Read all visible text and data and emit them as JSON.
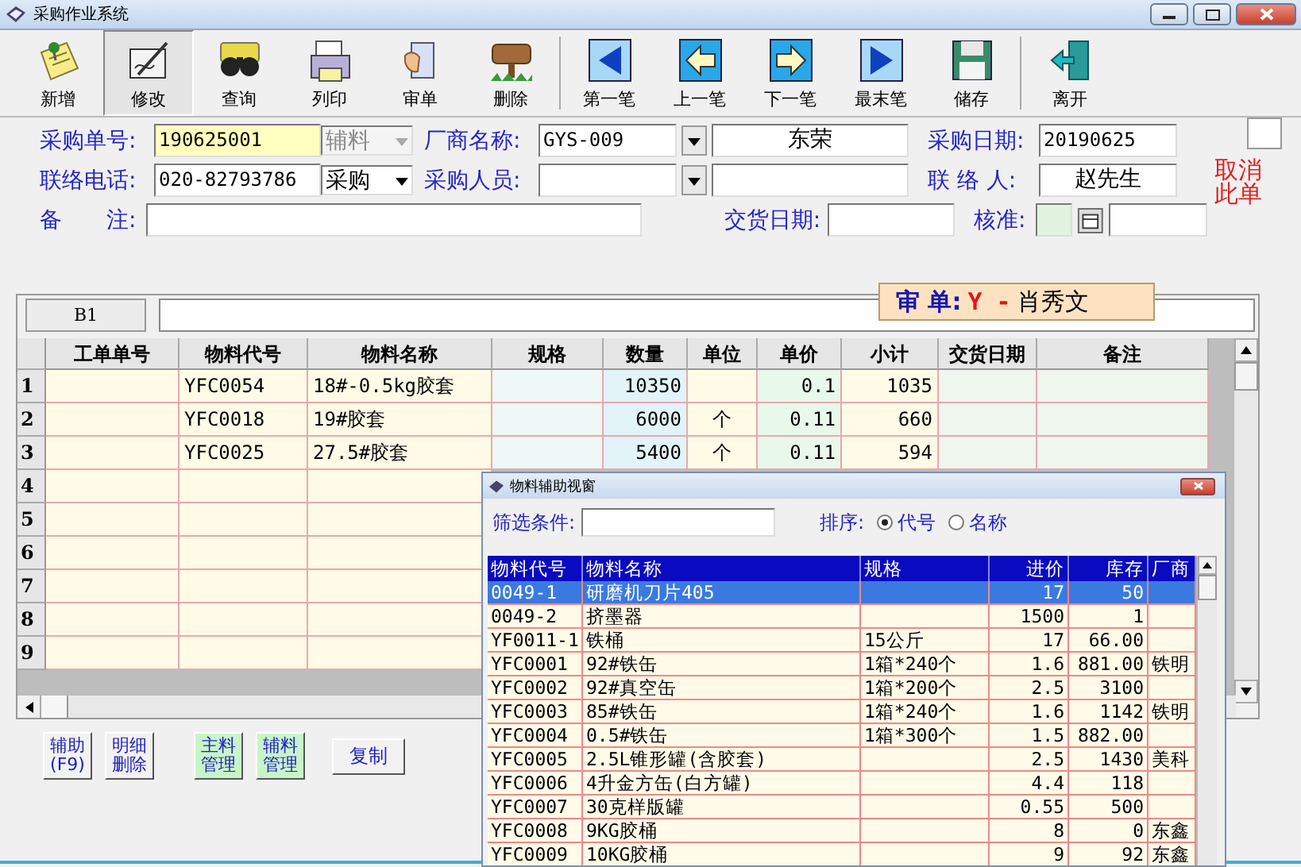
{
  "window": {
    "title": "采购作业系统"
  },
  "toolbar": [
    [
      {
        "label": "新增",
        "kind": "note",
        "selected": false
      },
      {
        "label": "修改",
        "kind": "pen",
        "selected": true
      },
      {
        "label": "查询",
        "kind": "binoculars",
        "selected": false
      },
      {
        "label": "列印",
        "kind": "printer",
        "selected": false
      },
      {
        "label": "审单",
        "kind": "hand",
        "selected": false
      },
      {
        "label": "删除",
        "kind": "sign",
        "selected": false
      }
    ],
    [
      {
        "label": "第一笔",
        "kind": "first",
        "selected": false
      },
      {
        "label": "上一笔",
        "kind": "prev",
        "selected": false
      },
      {
        "label": "下一笔",
        "kind": "next",
        "selected": false
      },
      {
        "label": "最末笔",
        "kind": "last",
        "selected": false
      },
      {
        "label": "储存",
        "kind": "disk",
        "selected": false
      }
    ],
    [
      {
        "label": "离开",
        "kind": "door",
        "selected": false
      }
    ]
  ],
  "form": {
    "order_no": {
      "label": "采购单号:",
      "value": "190625001"
    },
    "material_type": {
      "value": "辅料",
      "disabled": true
    },
    "vendor": {
      "label": "厂商名称:",
      "code": "GYS-009",
      "name": "东荣"
    },
    "purchase_date": {
      "label": "采购日期:",
      "value": "20190625"
    },
    "phone": {
      "label": "联络电话:",
      "value": "020-82793786"
    },
    "purchase_type": {
      "value": "采购",
      "disabled": false
    },
    "buyer": {
      "label": "采购人员:"
    },
    "contact": {
      "label": "联 络 人:",
      "value": "赵先生"
    },
    "remark": {
      "label": "备　　注:"
    },
    "delivery_date": {
      "label": "交货日期:"
    },
    "approval": {
      "label": "核准:"
    },
    "cancel_link": "取消此单"
  },
  "audit": {
    "label": "审 单:",
    "flag": "Y -",
    "name": "肖秀文"
  },
  "grid": {
    "cell_ref": "B1",
    "columns": [
      "工单单号",
      "物料代号",
      "物料名称",
      "规格",
      "数量",
      "单位",
      "单价",
      "小计",
      "交货日期",
      "备注"
    ],
    "rows": [
      {
        "number": "1",
        "code": "YFC0054",
        "name": "18#-0.5kg胶套",
        "qty": "10350",
        "price": "0.1",
        "subtotal": "1035"
      },
      {
        "number": "2",
        "code": "YFC0018",
        "name": "19#胶套",
        "qty": "6000",
        "unit": "个",
        "price": "0.11",
        "subtotal": "660"
      },
      {
        "number": "3",
        "code": "YFC0025",
        "name": "27.5#胶套",
        "qty": "5400",
        "unit": "个",
        "price": "0.11",
        "subtotal": "594"
      },
      {
        "number": "4"
      },
      {
        "number": "5"
      },
      {
        "number": "6"
      },
      {
        "number": "7"
      },
      {
        "number": "8"
      },
      {
        "number": "9"
      }
    ]
  },
  "buttons": [
    {
      "label": "辅助(F9)",
      "color": "#f2f2f2"
    },
    {
      "label": "明细删除",
      "color": "#f2f2f2"
    },
    {
      "label": "主料管理",
      "color": "#c8f5c8"
    },
    {
      "label": "辅料管理",
      "color": "#c8f5c8"
    },
    {
      "label": "复制",
      "color": "#f2f2f2"
    }
  ],
  "lookup": {
    "title": "物料辅助视窗",
    "filter_label": "筛选条件:",
    "sort_label": "排序:",
    "sort_options": [
      {
        "label": "代号",
        "selected": true
      },
      {
        "label": "名称",
        "selected": false
      }
    ],
    "columns": [
      "物料代号",
      "物料名称",
      "规格",
      "进价",
      "库存",
      "厂商"
    ],
    "rows": [
      {
        "code": "0049-1",
        "name": "研磨机刀片405",
        "price": "17",
        "stock": "50",
        "selected": true
      },
      {
        "code": "0049-2",
        "name": "挤墨器",
        "price": "1500",
        "stock": "1",
        "selected": false
      },
      {
        "code": "YF0011-1",
        "name": "铁桶",
        "spec": "15公斤",
        "price": "17",
        "stock": "66.00",
        "selected": false
      },
      {
        "code": "YFC0001",
        "name": "92#铁缶",
        "spec": "1箱*240个",
        "price": "1.6",
        "stock": "881.00",
        "vendor": "铁明",
        "selected": false
      },
      {
        "code": "YFC0002",
        "name": "92#真空缶",
        "spec": "1箱*200个",
        "price": "2.5",
        "stock": "3100",
        "selected": false
      },
      {
        "code": "YFC0003",
        "name": "85#铁缶",
        "spec": "1箱*240个",
        "price": "1.6",
        "stock": "1142",
        "vendor": "铁明",
        "selected": false
      },
      {
        "code": "YFC0004",
        "name": "0.5#铁缶",
        "spec": "1箱*300个",
        "price": "1.5",
        "stock": "882.00",
        "selected": false
      },
      {
        "code": "YFC0005",
        "name": "2.5L锥形罐(含胶套)",
        "price": "2.5",
        "stock": "1430",
        "vendor": "美科",
        "selected": false
      },
      {
        "code": "YFC0006",
        "name": "4升金方缶(白方罐)",
        "price": "4.4",
        "stock": "118",
        "selected": false
      },
      {
        "code": "YFC0007",
        "name": "30克样版罐",
        "price": "0.55",
        "stock": "500",
        "selected": false
      },
      {
        "code": "YFC0008",
        "name": "9KG胶桶",
        "price": "8",
        "stock": "0",
        "vendor": "东鑫",
        "selected": false
      },
      {
        "code": "YFC0009",
        "name": "10KG胶桶",
        "price": "9",
        "stock": "92",
        "vendor": "东鑫",
        "selected": false
      }
    ]
  }
}
